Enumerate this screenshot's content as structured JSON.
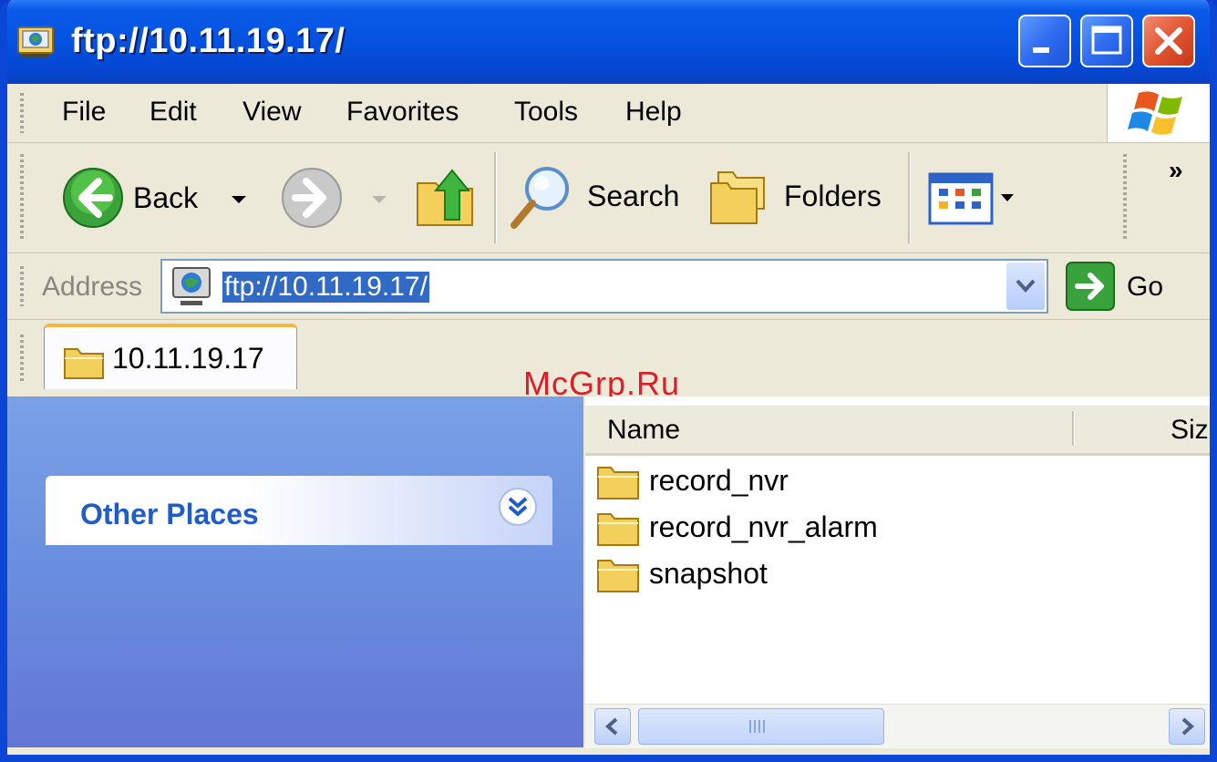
{
  "window": {
    "title": "ftp://10.11.19.17/",
    "controls": [
      "minimize",
      "maximize",
      "close"
    ]
  },
  "menu": {
    "items": [
      "File",
      "Edit",
      "View",
      "Favorites",
      "Tools",
      "Help"
    ]
  },
  "toolbar": {
    "back_label": "Back",
    "search_label": "Search",
    "folders_label": "Folders",
    "chevron": "»"
  },
  "address": {
    "label": "Address",
    "value": "ftp://10.11.19.17/",
    "go_label": "Go"
  },
  "tab": {
    "label": "10.11.19.17"
  },
  "watermark": "McGrp.Ru",
  "task_pane": {
    "section_title": "Other Places"
  },
  "file_list": {
    "columns": [
      "Name",
      "Siz"
    ],
    "items": [
      {
        "name": "record_nvr",
        "icon": "folder-icon"
      },
      {
        "name": "record_nvr_alarm",
        "icon": "folder-icon"
      },
      {
        "name": "snapshot",
        "icon": "folder-icon"
      }
    ]
  },
  "colors": {
    "titlebar": "#0653e2",
    "task_pane": "#6a8edf",
    "selection": "#316ac5",
    "watermark": "#d92028"
  }
}
